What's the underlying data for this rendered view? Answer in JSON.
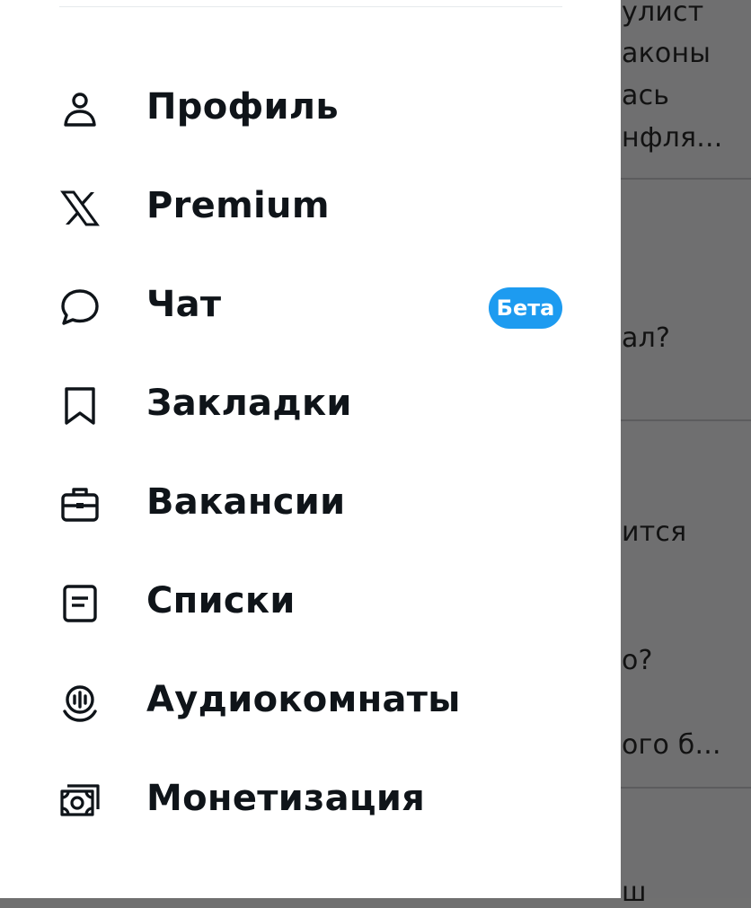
{
  "background_feed": {
    "lines": [
      "улист",
      "аконы",
      "ась",
      "нфля...",
      "ал?",
      "ится",
      "о?",
      "ого б...",
      "ш"
    ]
  },
  "menu": {
    "items": [
      {
        "label": "Профиль",
        "icon": "person-icon"
      },
      {
        "label": "Premium",
        "icon": "x-logo-icon"
      },
      {
        "label": "Чат",
        "icon": "chat-bubble-icon",
        "badge": "Бета"
      },
      {
        "label": "Закладки",
        "icon": "bookmark-icon"
      },
      {
        "label": "Вакансии",
        "icon": "briefcase-icon"
      },
      {
        "label": "Списки",
        "icon": "list-document-icon"
      },
      {
        "label": "Аудиокомнаты",
        "icon": "spaces-microphone-icon"
      },
      {
        "label": "Монетизация",
        "icon": "money-icon"
      }
    ]
  },
  "colors": {
    "accent": "#1d9bf0",
    "text": "#0f1419",
    "overlay": "#6f6f70"
  }
}
